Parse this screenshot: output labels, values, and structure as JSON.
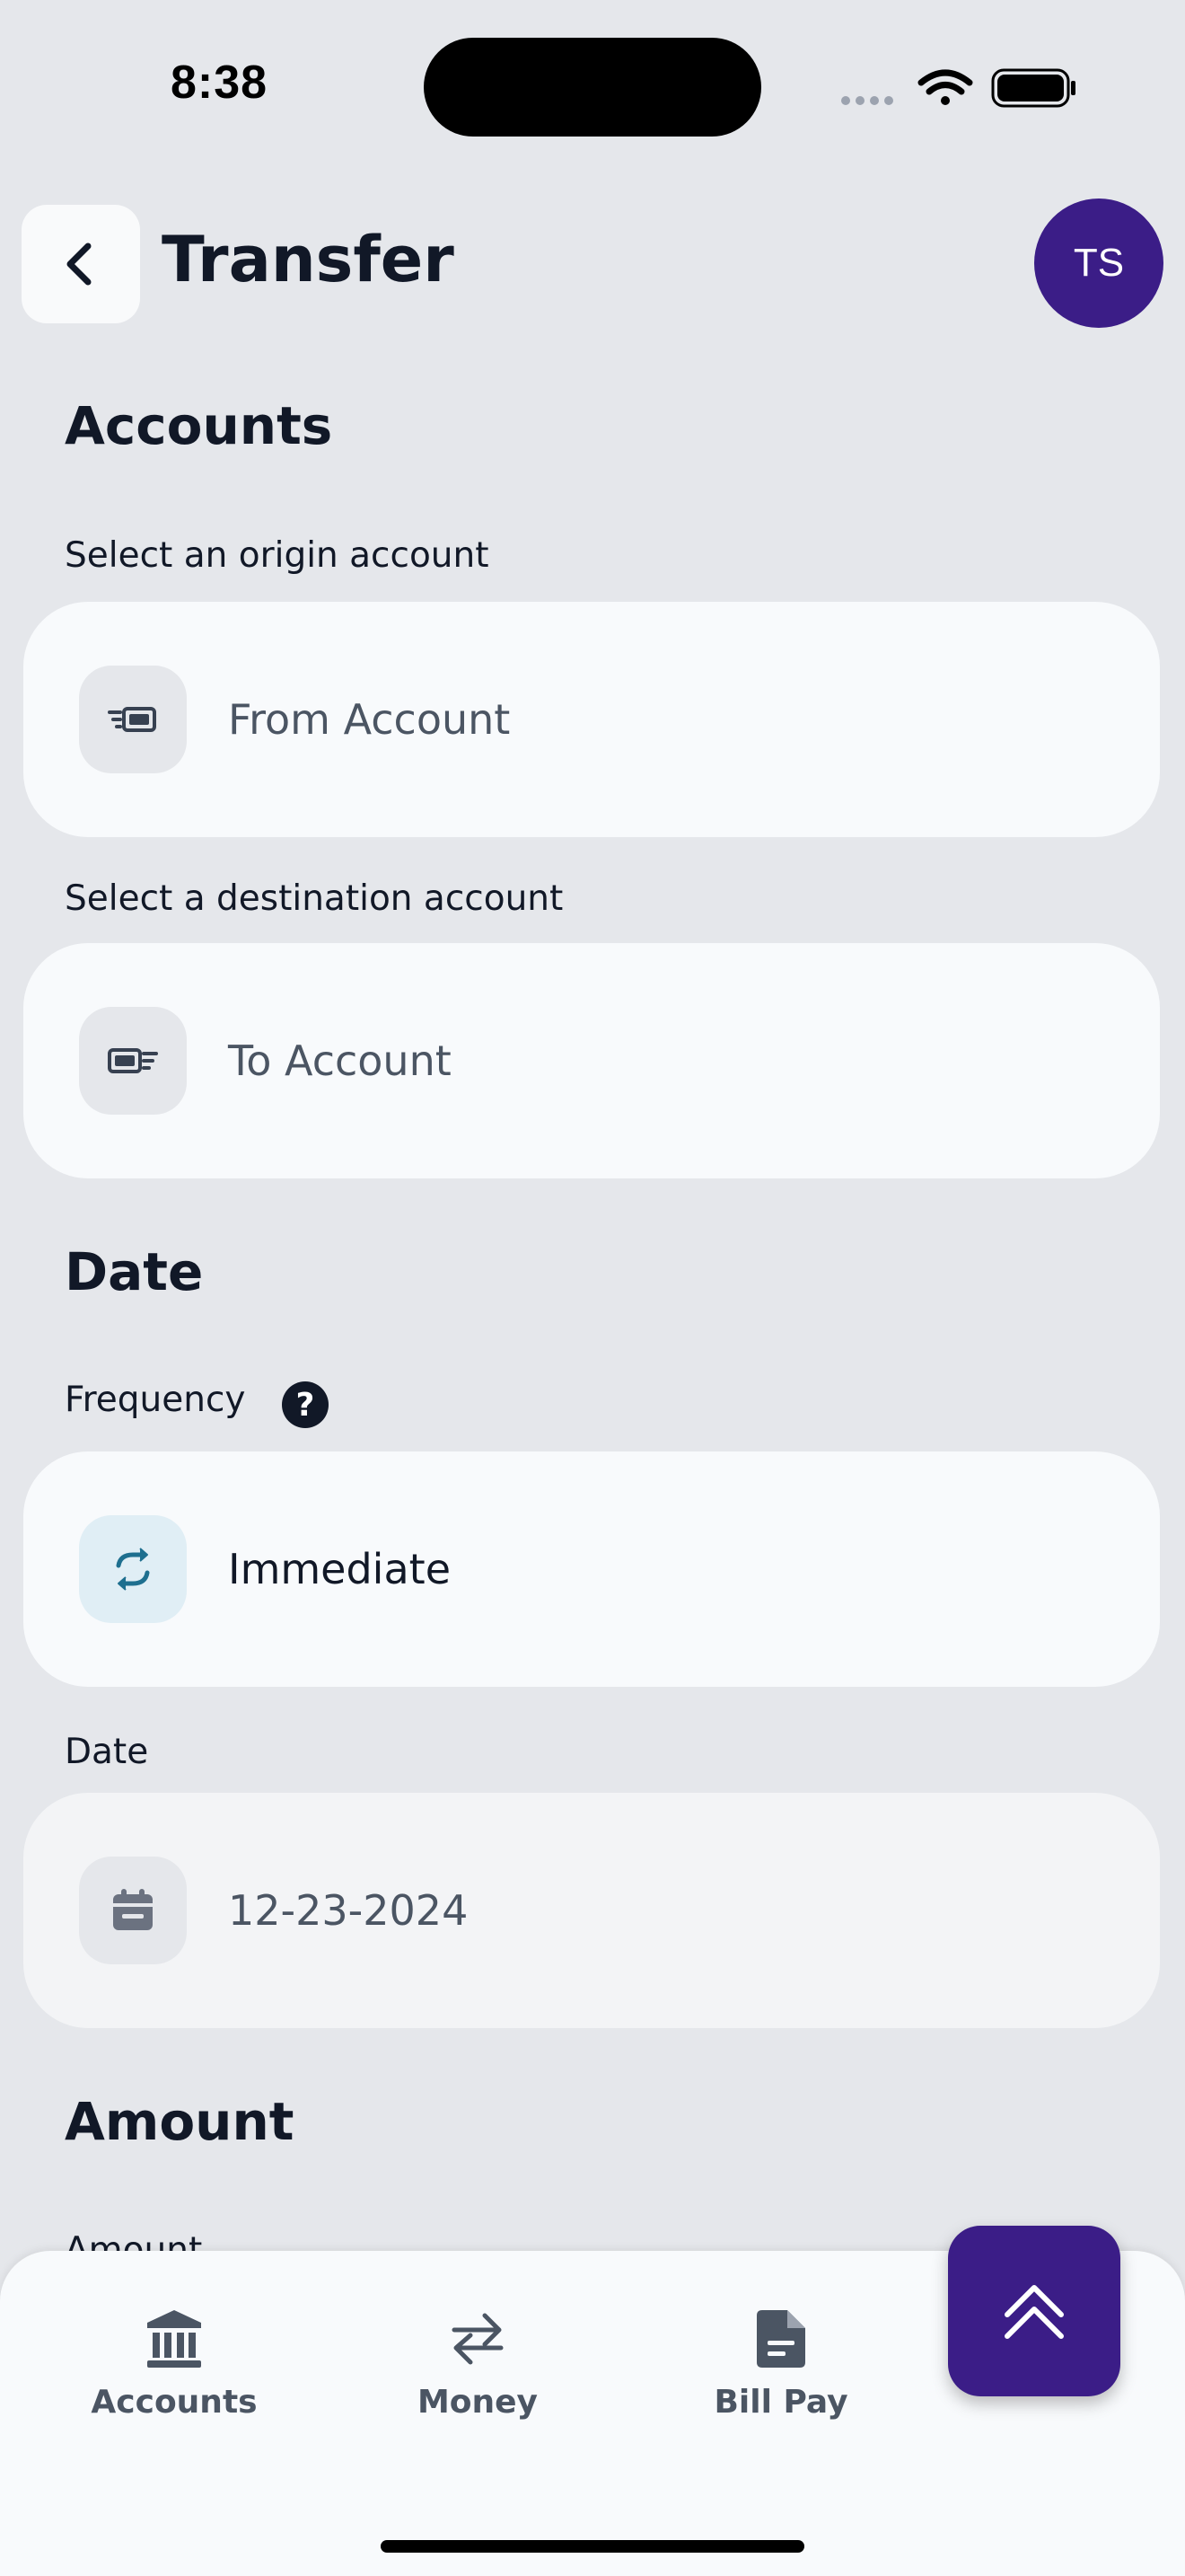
{
  "status_bar": {
    "time": "8:38"
  },
  "header": {
    "title": "Transfer",
    "avatar_initials": "TS"
  },
  "accounts": {
    "section_title": "Accounts",
    "origin_label": "Select an origin account",
    "origin_placeholder": "From Account",
    "destination_label": "Select a destination account",
    "destination_placeholder": "To Account"
  },
  "date_section": {
    "section_title": "Date",
    "frequency_label": "Frequency",
    "frequency_value": "Immediate",
    "date_label": "Date",
    "date_value": "12-23-2024"
  },
  "amount_section": {
    "section_title": "Amount",
    "amount_label": "Amount"
  },
  "bottom_nav": {
    "items": [
      {
        "label": "Accounts",
        "icon": "bank-icon"
      },
      {
        "label": "Money",
        "icon": "transfer-arrows-icon"
      },
      {
        "label": "Bill Pay",
        "icon": "document-icon"
      }
    ],
    "fab_icon": "double-chevron-up-icon"
  },
  "colors": {
    "brand": "#3b1d87",
    "accent_icon": "#1e6f8f",
    "background": "#e5e7eb"
  }
}
